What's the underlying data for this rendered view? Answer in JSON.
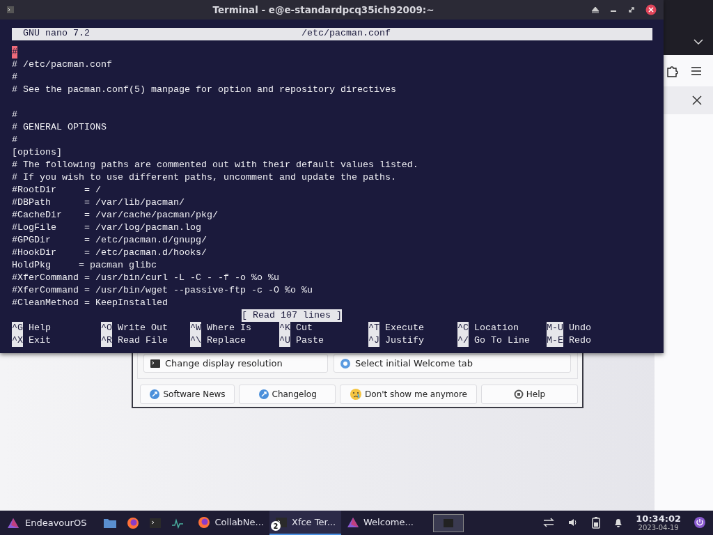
{
  "terminal": {
    "title": "Terminal - e@e-standardpcq35ich92009:~",
    "nano": {
      "version": "GNU nano 7.2",
      "filename": "/etc/pacman.conf",
      "lines": [
        {
          "kind": "text",
          "text": "#",
          "cursor": true
        },
        {
          "kind": "text",
          "text": "# /etc/pacman.conf",
          "cursor": false
        },
        {
          "kind": "text",
          "text": "#",
          "cursor": false
        },
        {
          "kind": "text",
          "text": "# See the pacman.conf(5) manpage for option and repository directives",
          "cursor": false
        },
        {
          "kind": "blank"
        },
        {
          "kind": "text",
          "text": "#",
          "cursor": false
        },
        {
          "kind": "text",
          "text": "# GENERAL OPTIONS",
          "cursor": false
        },
        {
          "kind": "text",
          "text": "#",
          "cursor": false
        },
        {
          "kind": "text",
          "text": "[options]",
          "cursor": false
        },
        {
          "kind": "text",
          "text": "# The following paths are commented out with their default values listed.",
          "cursor": false
        },
        {
          "kind": "text",
          "text": "# If you wish to use different paths, uncomment and update the paths.",
          "cursor": false
        },
        {
          "kind": "text",
          "text": "#RootDir     = /",
          "cursor": false
        },
        {
          "kind": "text",
          "text": "#DBPath      = /var/lib/pacman/",
          "cursor": false
        },
        {
          "kind": "text",
          "text": "#CacheDir    = /var/cache/pacman/pkg/",
          "cursor": false
        },
        {
          "kind": "text",
          "text": "#LogFile     = /var/log/pacman.log",
          "cursor": false
        },
        {
          "kind": "text",
          "text": "#GPGDir      = /etc/pacman.d/gnupg/",
          "cursor": false
        },
        {
          "kind": "text",
          "text": "#HookDir     = /etc/pacman.d/hooks/",
          "cursor": false
        },
        {
          "kind": "text",
          "text": "HoldPkg     = pacman glibc",
          "cursor": false
        },
        {
          "kind": "text",
          "text": "#XferCommand = /usr/bin/curl -L -C - -f -o %o %u",
          "cursor": false
        },
        {
          "kind": "text",
          "text": "#XferCommand = /usr/bin/wget --passive-ftp -c -O %o %u",
          "cursor": false
        },
        {
          "kind": "text",
          "text": "#CleanMethod = KeepInstalled",
          "cursor": false
        }
      ],
      "status": "[ Read 107 lines ]",
      "shortcuts": [
        [
          {
            "key": "^G",
            "label": "Help"
          },
          {
            "key": "^O",
            "label": "Write Out"
          },
          {
            "key": "^W",
            "label": "Where Is"
          },
          {
            "key": "^K",
            "label": "Cut"
          },
          {
            "key": "^T",
            "label": "Execute"
          },
          {
            "key": "^C",
            "label": "Location"
          },
          {
            "key": "M-U",
            "label": "Undo"
          }
        ],
        [
          {
            "key": "^X",
            "label": "Exit"
          },
          {
            "key": "^R",
            "label": "Read File"
          },
          {
            "key": "^\\",
            "label": "Replace"
          },
          {
            "key": "^U",
            "label": "Paste"
          },
          {
            "key": "^J",
            "label": "Justify"
          },
          {
            "key": "^/",
            "label": "Go To Line"
          },
          {
            "key": "M-E",
            "label": "Redo"
          }
        ]
      ]
    }
  },
  "welcome": {
    "tasks": [
      {
        "kind": "terminal",
        "label": "Change display resolution"
      },
      {
        "kind": "disc",
        "label": "Select initial Welcome tab"
      }
    ],
    "buttons": [
      {
        "kind": "link",
        "label": "Software News"
      },
      {
        "kind": "link",
        "label": "Changelog"
      },
      {
        "kind": "sad",
        "label": "Don't show me anymore"
      },
      {
        "kind": "lifebuoy",
        "label": "Help"
      }
    ]
  },
  "taskbar": {
    "start": "EndeavourOS",
    "launchers": [
      {
        "kind": "folder"
      },
      {
        "kind": "firefox"
      },
      {
        "kind": "terminal"
      },
      {
        "kind": "monitor"
      }
    ],
    "tasks": [
      {
        "kind": "firefox",
        "label": "CollabNe...",
        "selected": false
      },
      {
        "kind": "terminal",
        "label": "Xfce Ter...",
        "badge": "2",
        "selected": true
      },
      {
        "kind": "endeavour",
        "label": "Welcome...",
        "selected": false
      }
    ],
    "time": "10:34:02",
    "date": "2023-04-19"
  }
}
